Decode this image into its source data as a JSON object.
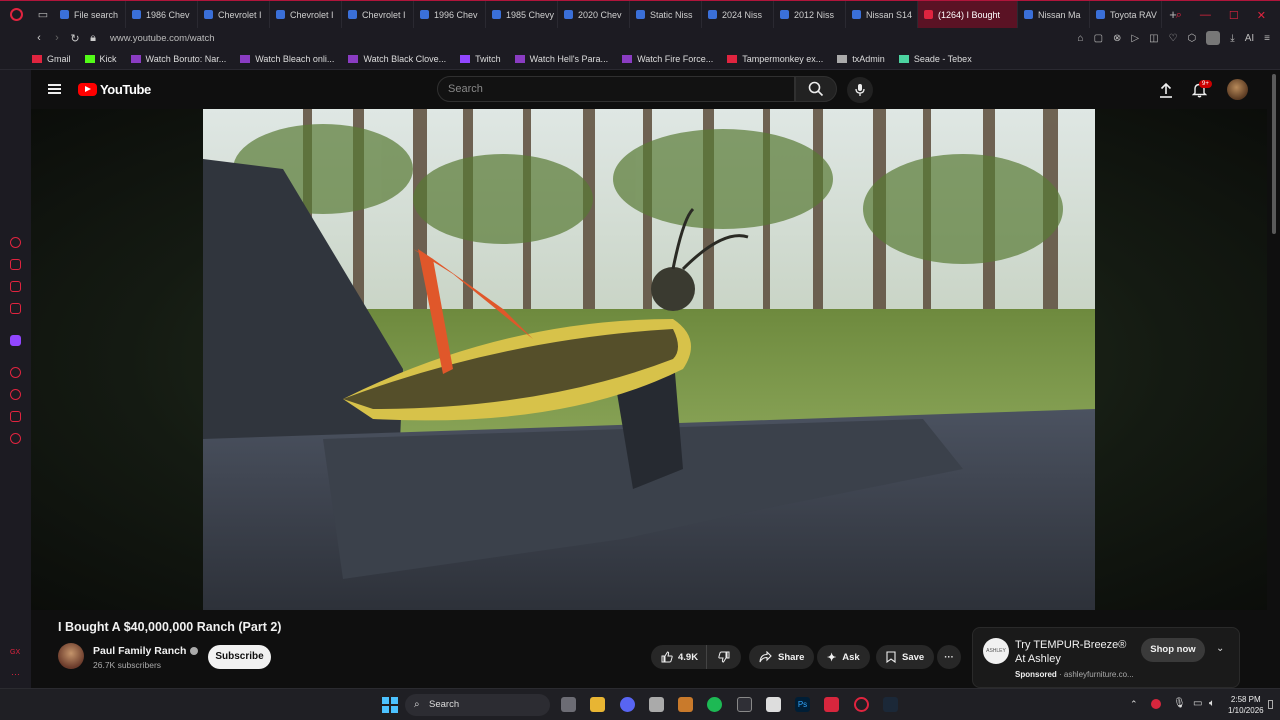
{
  "browser": {
    "tabs": [
      {
        "label": "File search",
        "active": false
      },
      {
        "label": "1986 Chev",
        "active": false
      },
      {
        "label": "Chevrolet I",
        "active": false
      },
      {
        "label": "Chevrolet I",
        "active": false
      },
      {
        "label": "Chevrolet I",
        "active": false
      },
      {
        "label": "1996 Chev",
        "active": false
      },
      {
        "label": "1985 Chevy",
        "active": false
      },
      {
        "label": "2020 Chev",
        "active": false
      },
      {
        "label": "Static Niss",
        "active": false
      },
      {
        "label": "2024 Niss",
        "active": false
      },
      {
        "label": "2012 Niss",
        "active": false
      },
      {
        "label": "Nissan S14",
        "active": false
      },
      {
        "label": "(1264) I Bought",
        "active": true
      },
      {
        "label": "Nissan Ma",
        "active": false
      },
      {
        "label": "Toyota RAV",
        "active": false
      }
    ],
    "url": "www.youtube.com/watch",
    "ai_label": "AI",
    "bookmarks": [
      {
        "label": "Gmail",
        "color": "#e0243f"
      },
      {
        "label": "Kick",
        "color": "#53fc18"
      },
      {
        "label": "Watch Boruto: Nar...",
        "color": "#8a3cc2"
      },
      {
        "label": "Watch Bleach onli...",
        "color": "#8a3cc2"
      },
      {
        "label": "Watch Black Clove...",
        "color": "#8a3cc2"
      },
      {
        "label": "Twitch",
        "color": "#9146ff"
      },
      {
        "label": "Watch Hell's Para...",
        "color": "#8a3cc2"
      },
      {
        "label": "Watch Fire Force...",
        "color": "#8a3cc2"
      },
      {
        "label": "Tampermonkey ex...",
        "color": "#e0243f"
      },
      {
        "label": "txAdmin",
        "color": "#aaaaaa"
      },
      {
        "label": "Seade - Tebex",
        "color": "#4cd3a0"
      }
    ]
  },
  "youtube": {
    "logo_text": "YouTube",
    "search_placeholder": "Search",
    "notif_count": "9+",
    "video": {
      "title": "I Bought A $40,000,000 Ranch (Part 2)",
      "channel": "Paul Family Ranch",
      "subscribers": "26.7K subscribers",
      "subscribe_label": "Subscribe",
      "likes": "4.9K",
      "share_label": "Share",
      "ask_label": "Ask",
      "save_label": "Save"
    },
    "ad": {
      "title": "Try TEMPUR-Breeze® At Ashley",
      "sponsored": "Sponsored",
      "domain": "ashleyfurniture.co...",
      "cta": "Shop now",
      "logo_text": "ASHLEY"
    }
  },
  "taskbar": {
    "search_label": "Search",
    "time": "2:58 PM",
    "date": "1/10/2026"
  },
  "colors": {
    "accent": "#e0243f",
    "youtube_red": "#ff0000",
    "background": "#0f0f0f"
  }
}
